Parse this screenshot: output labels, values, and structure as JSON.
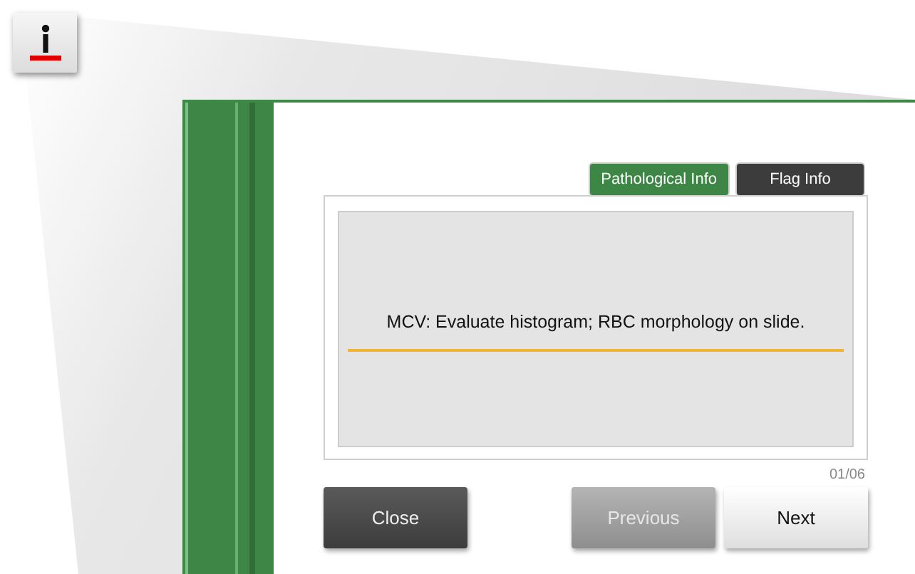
{
  "tabs": [
    {
      "label": "Pathological Info",
      "selected": true
    },
    {
      "label": "Flag Info",
      "selected": false
    }
  ],
  "message": "MCV: Evaluate histogram; RBC morphology on slide.",
  "page_counter": "01/06",
  "buttons": [
    {
      "label": "Close",
      "kind": "dark",
      "disabled": false
    },
    {
      "label": "Previous",
      "kind": "light",
      "disabled": true
    },
    {
      "label": "Next",
      "kind": "light",
      "disabled": false
    }
  ]
}
